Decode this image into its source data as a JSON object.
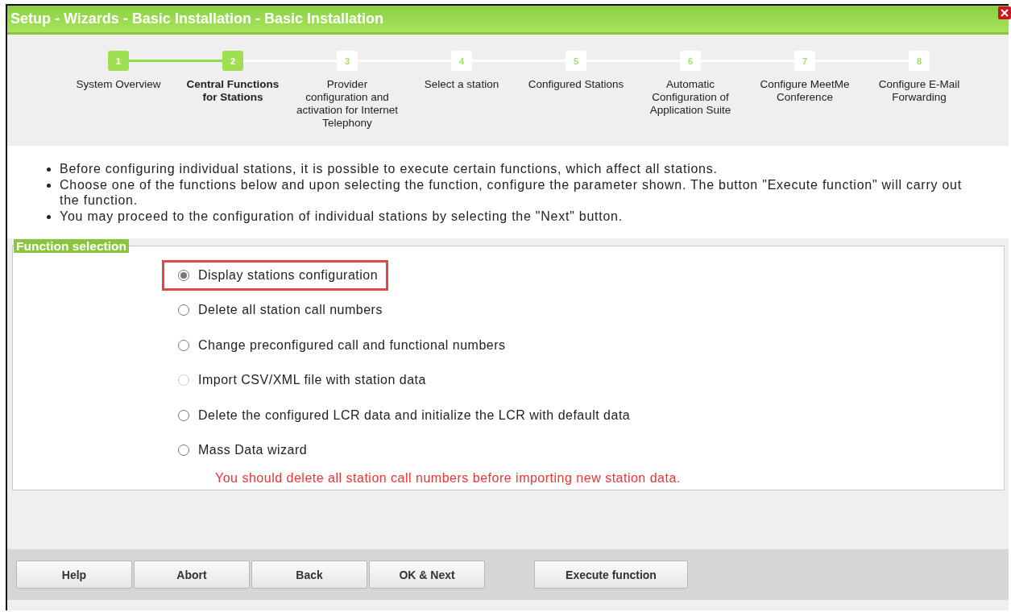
{
  "window": {
    "title": "Setup - Wizards - Basic Installation - Basic Installation"
  },
  "steps": [
    {
      "number": "1",
      "label": "System Overview",
      "completed": true,
      "current": false
    },
    {
      "number": "2",
      "label": "Central Functions for Stations",
      "completed": true,
      "current": true
    },
    {
      "number": "3",
      "label": "Provider configuration and activation for Internet Telephony",
      "completed": false,
      "current": false
    },
    {
      "number": "4",
      "label": "Select a station",
      "completed": false,
      "current": false
    },
    {
      "number": "5",
      "label": "Configured Stations",
      "completed": false,
      "current": false
    },
    {
      "number": "6",
      "label": "Automatic Configuration of Application Suite",
      "completed": false,
      "current": false
    },
    {
      "number": "7",
      "label": "Configure MeetMe Conference",
      "completed": false,
      "current": false
    },
    {
      "number": "8",
      "label": "Configure E-Mail Forwarding",
      "completed": false,
      "current": false
    }
  ],
  "instructions": [
    "Before configuring individual stations, it is possible to execute certain functions, which affect all stations.",
    "Choose one of the functions below and upon selecting the function, configure the parameter shown. The button \"Execute function\" will carry out the function.",
    "You may proceed to the configuration of individual stations by selecting the \"Next\" button."
  ],
  "function_selection": {
    "legend": "Function selection",
    "options": [
      {
        "label": "Display stations configuration",
        "selected": true,
        "disabled": false,
        "highlighted": true
      },
      {
        "label": "Delete all station call numbers",
        "selected": false,
        "disabled": false,
        "highlighted": false
      },
      {
        "label": "Change preconfigured call and functional numbers",
        "selected": false,
        "disabled": false,
        "highlighted": false
      },
      {
        "label": "Import CSV/XML file with station data",
        "selected": false,
        "disabled": true,
        "highlighted": false
      },
      {
        "label": "Delete the configured LCR data and initialize the LCR with default data",
        "selected": false,
        "disabled": false,
        "highlighted": false
      },
      {
        "label": "Mass Data wizard",
        "selected": false,
        "disabled": false,
        "highlighted": false
      }
    ],
    "warning": "You should delete all station call numbers before importing new station data."
  },
  "buttons": [
    {
      "label": "Help",
      "kind": "nav"
    },
    {
      "label": "Abort",
      "kind": "nav"
    },
    {
      "label": "Back",
      "kind": "nav"
    },
    {
      "label": "OK & Next",
      "kind": "nav"
    },
    {
      "label": "Execute function",
      "kind": "action"
    }
  ]
}
